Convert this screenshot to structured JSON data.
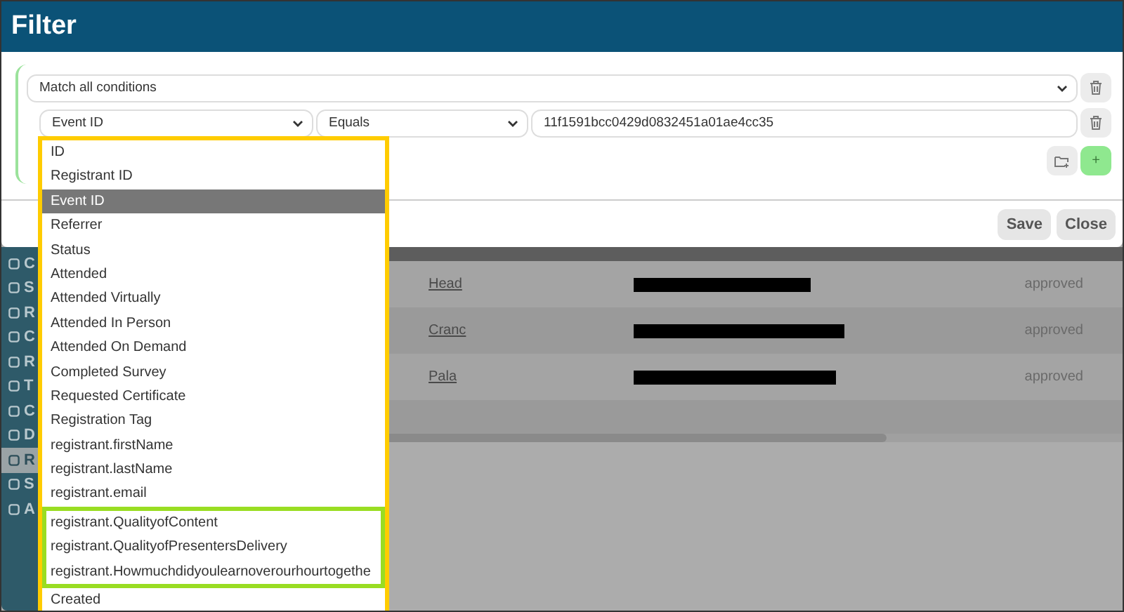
{
  "dialog": {
    "title": "Filter",
    "match_select": "Match all conditions",
    "condition": {
      "field": "Event ID",
      "operator": "Equals",
      "value": "11f1591bcc0429d0832451a01ae4cc35"
    },
    "add_button": "+",
    "buttons": [
      "Save",
      "Close"
    ]
  },
  "field_dropdown": {
    "options": [
      {
        "label": "ID",
        "selected": false,
        "highlighted": false
      },
      {
        "label": "Registrant ID",
        "selected": false,
        "highlighted": false
      },
      {
        "label": "Event ID",
        "selected": true,
        "highlighted": false
      },
      {
        "label": "Referrer",
        "selected": false,
        "highlighted": false
      },
      {
        "label": "Status",
        "selected": false,
        "highlighted": false
      },
      {
        "label": "Attended",
        "selected": false,
        "highlighted": false
      },
      {
        "label": "Attended Virtually",
        "selected": false,
        "highlighted": false
      },
      {
        "label": "Attended In Person",
        "selected": false,
        "highlighted": false
      },
      {
        "label": "Attended On Demand",
        "selected": false,
        "highlighted": false
      },
      {
        "label": "Completed Survey",
        "selected": false,
        "highlighted": false
      },
      {
        "label": "Requested Certificate",
        "selected": false,
        "highlighted": false
      },
      {
        "label": "Registration Tag",
        "selected": false,
        "highlighted": false
      },
      {
        "label": "registrant.firstName",
        "selected": false,
        "highlighted": false
      },
      {
        "label": "registrant.lastName",
        "selected": false,
        "highlighted": false
      },
      {
        "label": "registrant.email",
        "selected": false,
        "highlighted": false
      },
      {
        "label": "registrant.QualityofContent",
        "selected": false,
        "highlighted": true
      },
      {
        "label": "registrant.QualityofPresentersDelivery",
        "selected": false,
        "highlighted": true
      },
      {
        "label": "registrant.Howmuchdidyoulearnoverourhourtogethe",
        "selected": false,
        "highlighted": true
      },
      {
        "label": "Created",
        "selected": false,
        "highlighted": false
      }
    ]
  },
  "sidebar": {
    "items": [
      {
        "label": "C",
        "selected": false
      },
      {
        "label": "S",
        "selected": false
      },
      {
        "label": "R",
        "selected": false
      },
      {
        "label": "C",
        "selected": false
      },
      {
        "label": "R",
        "selected": false
      },
      {
        "label": "T",
        "selected": false
      },
      {
        "label": "C",
        "selected": false
      },
      {
        "label": "D",
        "selected": false
      },
      {
        "label": "R",
        "selected": true
      },
      {
        "label": "S",
        "selected": false
      },
      {
        "label": "A",
        "selected": false
      }
    ]
  },
  "table": {
    "rows": [
      {
        "name": "Head",
        "status": "approved"
      },
      {
        "name": "Cranc",
        "status": "approved"
      },
      {
        "name": "Pala",
        "status": "approved"
      }
    ]
  }
}
